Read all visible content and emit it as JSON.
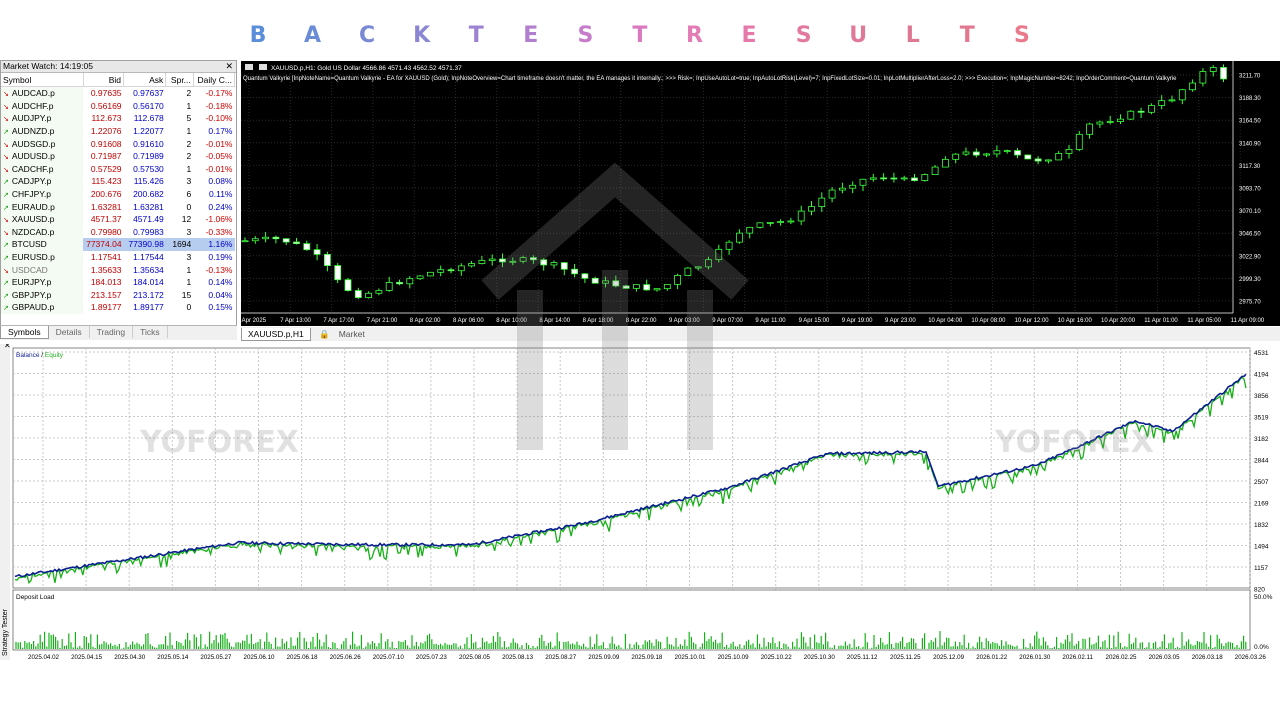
{
  "title": "BACKTESTRESULTS",
  "title_colors": [
    "#5b8ed8",
    "#6a8cd7",
    "#7a89d6",
    "#8b86d4",
    "#9d83d2",
    "#b27fcf",
    "#c77cca",
    "#d97ac0",
    "#e37bb5",
    "#e57aaa",
    "#e2799f",
    "#e07898",
    "#de7792",
    "#e2778f",
    "#e87a8c"
  ],
  "watermark": "YOFOREX",
  "market_watch": {
    "header": "Market Watch: 14:19:05",
    "columns": [
      "Symbol",
      "Bid",
      "Ask",
      "Spr...",
      "Daily C..."
    ],
    "rows": [
      {
        "symbol": "AUDCAD.p",
        "bid": "0.97635",
        "ask": "0.97637",
        "spread": "2",
        "change": "-0.17%",
        "dir": "down"
      },
      {
        "symbol": "AUDCHF.p",
        "bid": "0.56169",
        "ask": "0.56170",
        "spread": "1",
        "change": "-0.18%",
        "dir": "down"
      },
      {
        "symbol": "AUDJPY.p",
        "bid": "112.673",
        "ask": "112.678",
        "spread": "5",
        "change": "-0.10%",
        "dir": "down"
      },
      {
        "symbol": "AUDNZD.p",
        "bid": "1.22076",
        "ask": "1.22077",
        "spread": "1",
        "change": "0.17%",
        "dir": "up"
      },
      {
        "symbol": "AUDSGD.p",
        "bid": "0.91608",
        "ask": "0.91610",
        "spread": "2",
        "change": "-0.01%",
        "dir": "down"
      },
      {
        "symbol": "AUDUSD.p",
        "bid": "0.71987",
        "ask": "0.71989",
        "spread": "2",
        "change": "-0.05%",
        "dir": "down"
      },
      {
        "symbol": "CADCHF.p",
        "bid": "0.57529",
        "ask": "0.57530",
        "spread": "1",
        "change": "-0.01%",
        "dir": "down"
      },
      {
        "symbol": "CADJPY.p",
        "bid": "115.423",
        "ask": "115.426",
        "spread": "3",
        "change": "0.08%",
        "dir": "up"
      },
      {
        "symbol": "CHFJPY.p",
        "bid": "200.676",
        "ask": "200.682",
        "spread": "6",
        "change": "0.11%",
        "dir": "up"
      },
      {
        "symbol": "EURAUD.p",
        "bid": "1.63281",
        "ask": "1.63281",
        "spread": "0",
        "change": "0.24%",
        "dir": "up"
      },
      {
        "symbol": "XAUUSD.p",
        "bid": "4571.37",
        "ask": "4571.49",
        "spread": "12",
        "change": "-1.06%",
        "dir": "down"
      },
      {
        "symbol": "NZDCAD.p",
        "bid": "0.79980",
        "ask": "0.79983",
        "spread": "3",
        "change": "-0.33%",
        "dir": "down"
      },
      {
        "symbol": "BTCUSD",
        "bid": "77374.04",
        "ask": "77390.98",
        "spread": "1694",
        "change": "1.16%",
        "dir": "up",
        "selected": true
      },
      {
        "symbol": "EURUSD.p",
        "bid": "1.17541",
        "ask": "1.17544",
        "spread": "3",
        "change": "0.19%",
        "dir": "up"
      },
      {
        "symbol": "USDCAD",
        "bid": "1.35633",
        "ask": "1.35634",
        "spread": "1",
        "change": "-0.13%",
        "dir": "down",
        "muted": true
      },
      {
        "symbol": "EURJPY.p",
        "bid": "184.013",
        "ask": "184.014",
        "spread": "1",
        "change": "0.14%",
        "dir": "up"
      },
      {
        "symbol": "GBPJPY.p",
        "bid": "213.157",
        "ask": "213.172",
        "spread": "15",
        "change": "0.04%",
        "dir": "up"
      },
      {
        "symbol": "GBPAUD.p",
        "bid": "1.89177",
        "ask": "1.89177",
        "spread": "0",
        "change": "0.15%",
        "dir": "up"
      }
    ],
    "tabs": [
      "Symbols",
      "Details",
      "Trading",
      "Ticks"
    ]
  },
  "price_chart": {
    "header": "XAUUSD.p,H1:  Gold US Dollar  4566.86 4571.43 4562.52 4571.37",
    "ea_info": "Quantum Valkyrie [InpNoteName=Quantum Valkyrie - EA for XAUUSD (Gold); InpNoteOverview=Chart timeframe doesn't matter, the EA manages it internally.; >>> Risk=; InpUseAutoLot=true; InpAutoLotRisk(Level)=7; InpFixedLotSize=0.01; InpLotMultiplierAfterLoss=2.0; >>> Execution=; InpMagicNumber=8242; InpOrderComment=Quantum Valkyrie",
    "y_labels": [
      "3211.70",
      "3188.30",
      "3164.50",
      "3140.90",
      "3117.30",
      "3093.70",
      "3070.10",
      "3046.50",
      "3022.90",
      "2999.30",
      "2975.70"
    ],
    "x_labels": [
      "7 Apr 2025",
      "7 Apr 13:00",
      "7 Apr 17:00",
      "7 Apr 21:00",
      "8 Apr 02:00",
      "8 Apr 06:00",
      "8 Apr 10:00",
      "8 Apr 14:00",
      "8 Apr 18:00",
      "8 Apr 22:00",
      "9 Apr 03:00",
      "9 Apr 07:00",
      "9 Apr 11:00",
      "9 Apr 15:00",
      "9 Apr 19:00",
      "9 Apr 23:00",
      "10 Apr 04:00",
      "10 Apr 08:00",
      "10 Apr 12:00",
      "10 Apr 16:00",
      "10 Apr 20:00",
      "11 Apr 01:00",
      "11 Apr 05:00",
      "11 Apr 09:00"
    ],
    "tabs": [
      "XAUUSD.p,H1",
      "Market"
    ]
  },
  "tester": {
    "legend_balance": "Balance",
    "legend_sep": " / ",
    "legend_equity": "Equity",
    "y_labels": [
      "4531",
      "4194",
      "3856",
      "3519",
      "3182",
      "2844",
      "2507",
      "2169",
      "1832",
      "1494",
      "1157",
      "820"
    ],
    "deposit_label": "Deposit Load",
    "deposit_y": [
      "50.0%",
      "0.0%"
    ],
    "side_label": "Strategy Tester",
    "x_labels": [
      "2025.04.02",
      "2025.04.15",
      "2025.04.30",
      "2025.05.14",
      "2025.05.27",
      "2025.06.10",
      "2025.06.18",
      "2025.06.26",
      "2025.07.10",
      "2025.07.23",
      "2025.08.05",
      "2025.08.13",
      "2025.08.27",
      "2025.09.09",
      "2025.09.18",
      "2025.10.01",
      "2025.10.09",
      "2025.10.22",
      "2025.10.30",
      "2025.11.12",
      "2025.11.25",
      "2025.12.09",
      "2026.01.22",
      "2026.01.30",
      "2026.02.11",
      "2026.02.25",
      "2026.03.05",
      "2026.03.18",
      "2026.03.26"
    ]
  },
  "chart_data": {
    "type": "line",
    "title": "",
    "series": [
      {
        "name": "Balance",
        "color": "#0b1f8f"
      },
      {
        "name": "Equity",
        "color": "#18b018"
      }
    ],
    "x": [
      "2025.04.02",
      "2025.05.27",
      "2025.07.10",
      "2025.08.13",
      "2025.09.18",
      "2025.10.30",
      "2025.11.25",
      "2025.12.09",
      "2025.12.12",
      "2026.01.30",
      "2026.02.25",
      "2026.03.05",
      "2026.03.26"
    ],
    "balance": [
      1000,
      1530,
      1500,
      1500,
      1830,
      2400,
      2930,
      2960,
      2420,
      2750,
      3450,
      3280,
      4180
    ],
    "ylim": [
      820,
      4531
    ]
  }
}
